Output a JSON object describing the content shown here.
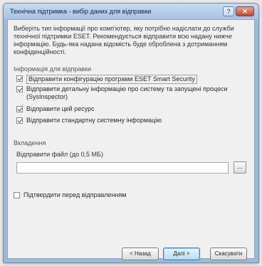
{
  "window": {
    "title": "Технічна підтримка - вибір даних для відправки",
    "help_label": "?",
    "close_label": "✕"
  },
  "intro_text": "Виберіть тип інформації про комп'ютер, яку потрібно надіслати до служби технічної підтримки ESET. Рекомендується відправити всю надану нижче інформацію. Будь-яка надана відомість буде оброблена з дотриманням конфіденційності.",
  "info_section": {
    "heading": "Інформація для відправки",
    "options": [
      {
        "label": "Відправити конфігурацію програми ESET Smart Security",
        "checked": true
      },
      {
        "label": "Відправити детальну інформацію про систему та запущені процеси (SysInspector)",
        "checked": true
      },
      {
        "label": "Відправити цей ресурс",
        "checked": true
      },
      {
        "label": "Відправити стандартну системну інформацію",
        "checked": true
      }
    ]
  },
  "attachments": {
    "heading": "Вкладення",
    "field_label": "Відправити файл (до 0,5 МБ)",
    "value": "",
    "browse_label": "..."
  },
  "confirm": {
    "label": "Підтвердити перед відправленням",
    "checked": false
  },
  "buttons": {
    "back": "< Назад",
    "next": "Далі >",
    "cancel": "Скасувати"
  }
}
